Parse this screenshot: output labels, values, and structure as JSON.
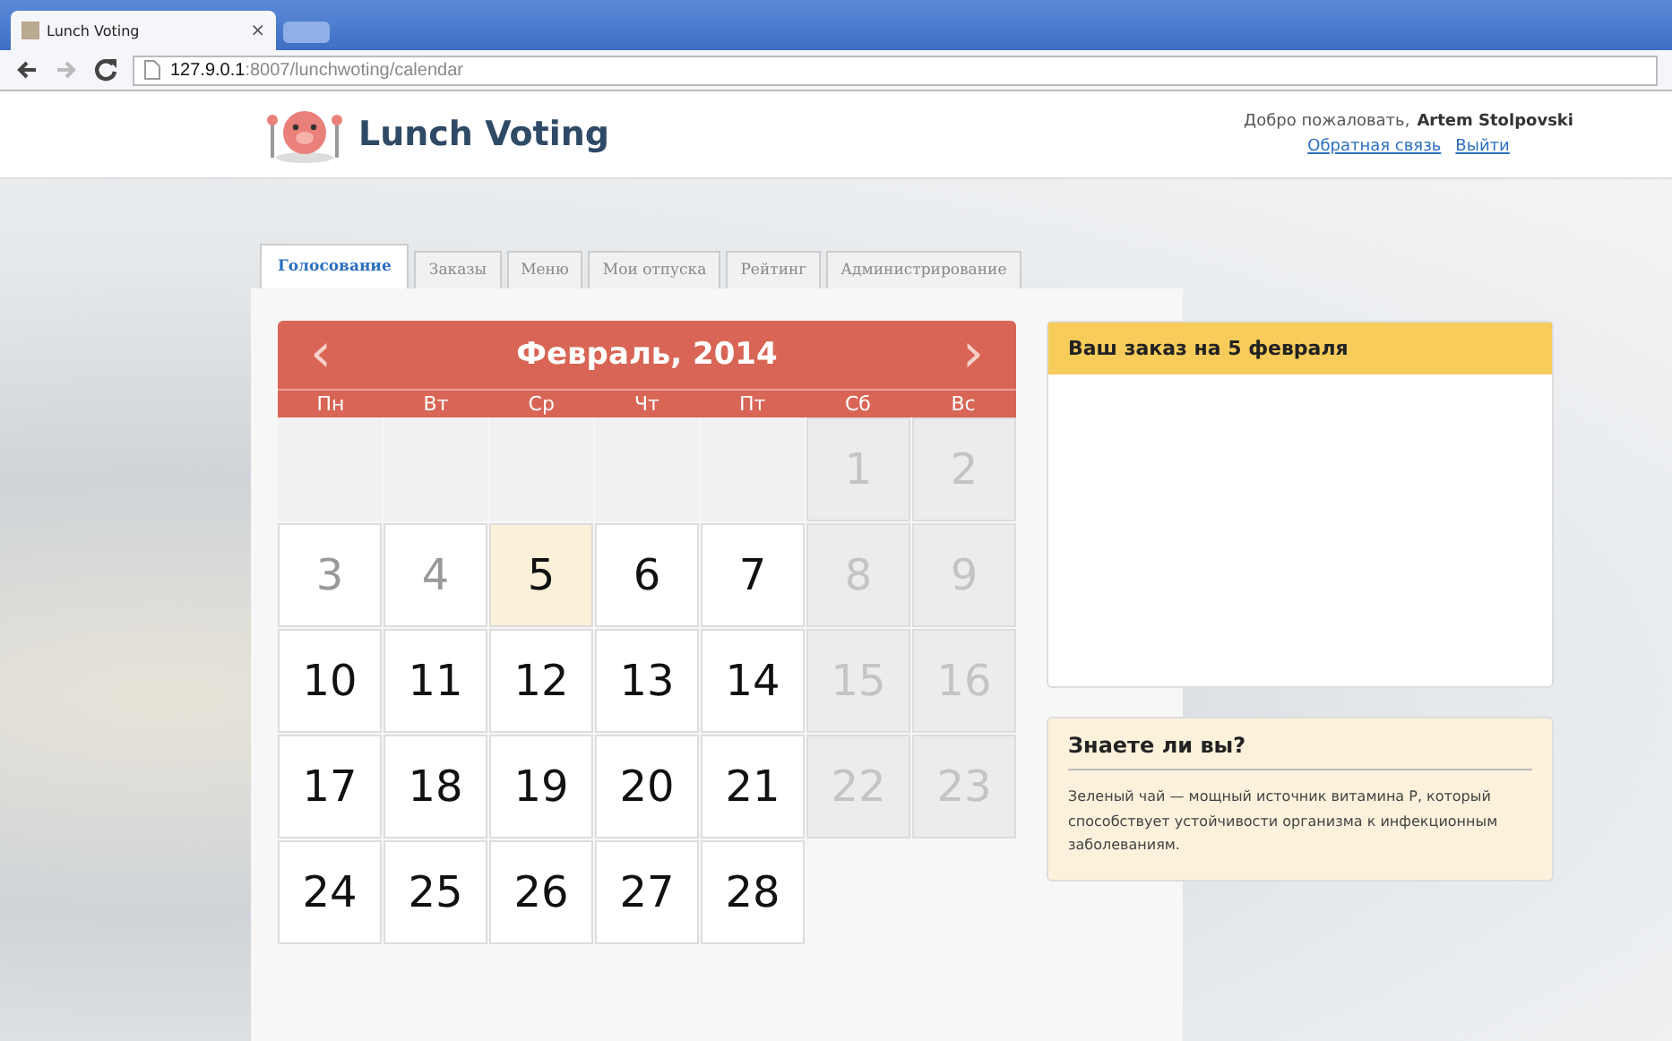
{
  "browser": {
    "tab_title": "Lunch Voting",
    "tab_close": "×",
    "address_host": "127.9.0.1",
    "address_path": ":8007/lunchwoting/calendar"
  },
  "header": {
    "logo_text": "Lunch Voting",
    "welcome": "Добро пожаловать,",
    "user": "Artem Stolpovski",
    "links": [
      "Обратная связь",
      "Выйти"
    ]
  },
  "tabs": [
    {
      "label": "Голосование",
      "selected": true
    },
    {
      "label": "Заказы",
      "selected": false
    },
    {
      "label": "Меню",
      "selected": false
    },
    {
      "label": "Мои отпуска",
      "selected": false
    },
    {
      "label": "Рейтинг",
      "selected": false
    },
    {
      "label": "Администрирование",
      "selected": false
    }
  ],
  "calendar": {
    "title": "Февраль, 2014",
    "prev": "‹",
    "next": "›",
    "weekdays": [
      "Пн",
      "Вт",
      "Ср",
      "Чт",
      "Пт",
      "Сб",
      "Вс"
    ],
    "days": [
      {
        "kind": "empty"
      },
      {
        "kind": "empty"
      },
      {
        "kind": "empty"
      },
      {
        "kind": "empty"
      },
      {
        "kind": "empty"
      },
      {
        "kind": "day",
        "label": "1",
        "weekend": true,
        "past": false,
        "selected": false
      },
      {
        "kind": "day",
        "label": "2",
        "weekend": true,
        "past": false,
        "selected": false
      },
      {
        "kind": "day",
        "label": "3",
        "weekend": false,
        "past": true,
        "selected": false
      },
      {
        "kind": "day",
        "label": "4",
        "weekend": false,
        "past": true,
        "selected": false
      },
      {
        "kind": "day",
        "label": "5",
        "weekend": false,
        "past": false,
        "selected": true
      },
      {
        "kind": "day",
        "label": "6",
        "weekend": false,
        "past": false,
        "selected": false
      },
      {
        "kind": "day",
        "label": "7",
        "weekend": false,
        "past": false,
        "selected": false
      },
      {
        "kind": "day",
        "label": "8",
        "weekend": true,
        "past": false,
        "selected": false
      },
      {
        "kind": "day",
        "label": "9",
        "weekend": true,
        "past": false,
        "selected": false
      },
      {
        "kind": "day",
        "label": "10",
        "weekend": false,
        "past": false,
        "selected": false
      },
      {
        "kind": "day",
        "label": "11",
        "weekend": false,
        "past": false,
        "selected": false
      },
      {
        "kind": "day",
        "label": "12",
        "weekend": false,
        "past": false,
        "selected": false
      },
      {
        "kind": "day",
        "label": "13",
        "weekend": false,
        "past": false,
        "selected": false
      },
      {
        "kind": "day",
        "label": "14",
        "weekend": false,
        "past": false,
        "selected": false
      },
      {
        "kind": "day",
        "label": "15",
        "weekend": true,
        "past": false,
        "selected": false
      },
      {
        "kind": "day",
        "label": "16",
        "weekend": true,
        "past": false,
        "selected": false
      },
      {
        "kind": "day",
        "label": "17",
        "weekend": false,
        "past": false,
        "selected": false
      },
      {
        "kind": "day",
        "label": "18",
        "weekend": false,
        "past": false,
        "selected": false
      },
      {
        "kind": "day",
        "label": "19",
        "weekend": false,
        "past": false,
        "selected": false
      },
      {
        "kind": "day",
        "label": "20",
        "weekend": false,
        "past": false,
        "selected": false
      },
      {
        "kind": "day",
        "label": "21",
        "weekend": false,
        "past": false,
        "selected": false
      },
      {
        "kind": "day",
        "label": "22",
        "weekend": true,
        "past": false,
        "selected": false
      },
      {
        "kind": "day",
        "label": "23",
        "weekend": true,
        "past": false,
        "selected": false
      },
      {
        "kind": "day",
        "label": "24",
        "weekend": false,
        "past": false,
        "selected": false
      },
      {
        "kind": "day",
        "label": "25",
        "weekend": false,
        "past": false,
        "selected": false
      },
      {
        "kind": "day",
        "label": "26",
        "weekend": false,
        "past": false,
        "selected": false
      },
      {
        "kind": "day",
        "label": "27",
        "weekend": false,
        "past": false,
        "selected": false
      },
      {
        "kind": "day",
        "label": "28",
        "weekend": false,
        "past": false,
        "selected": false
      }
    ]
  },
  "order_card": {
    "title": "Ваш заказ на 5 февраля"
  },
  "fact_card": {
    "title": "Знаете ли вы?",
    "text": "Зеленый чай — мощный источник витамина Р, который способствует устойчивости организма к инфекционным заболеваниям."
  }
}
